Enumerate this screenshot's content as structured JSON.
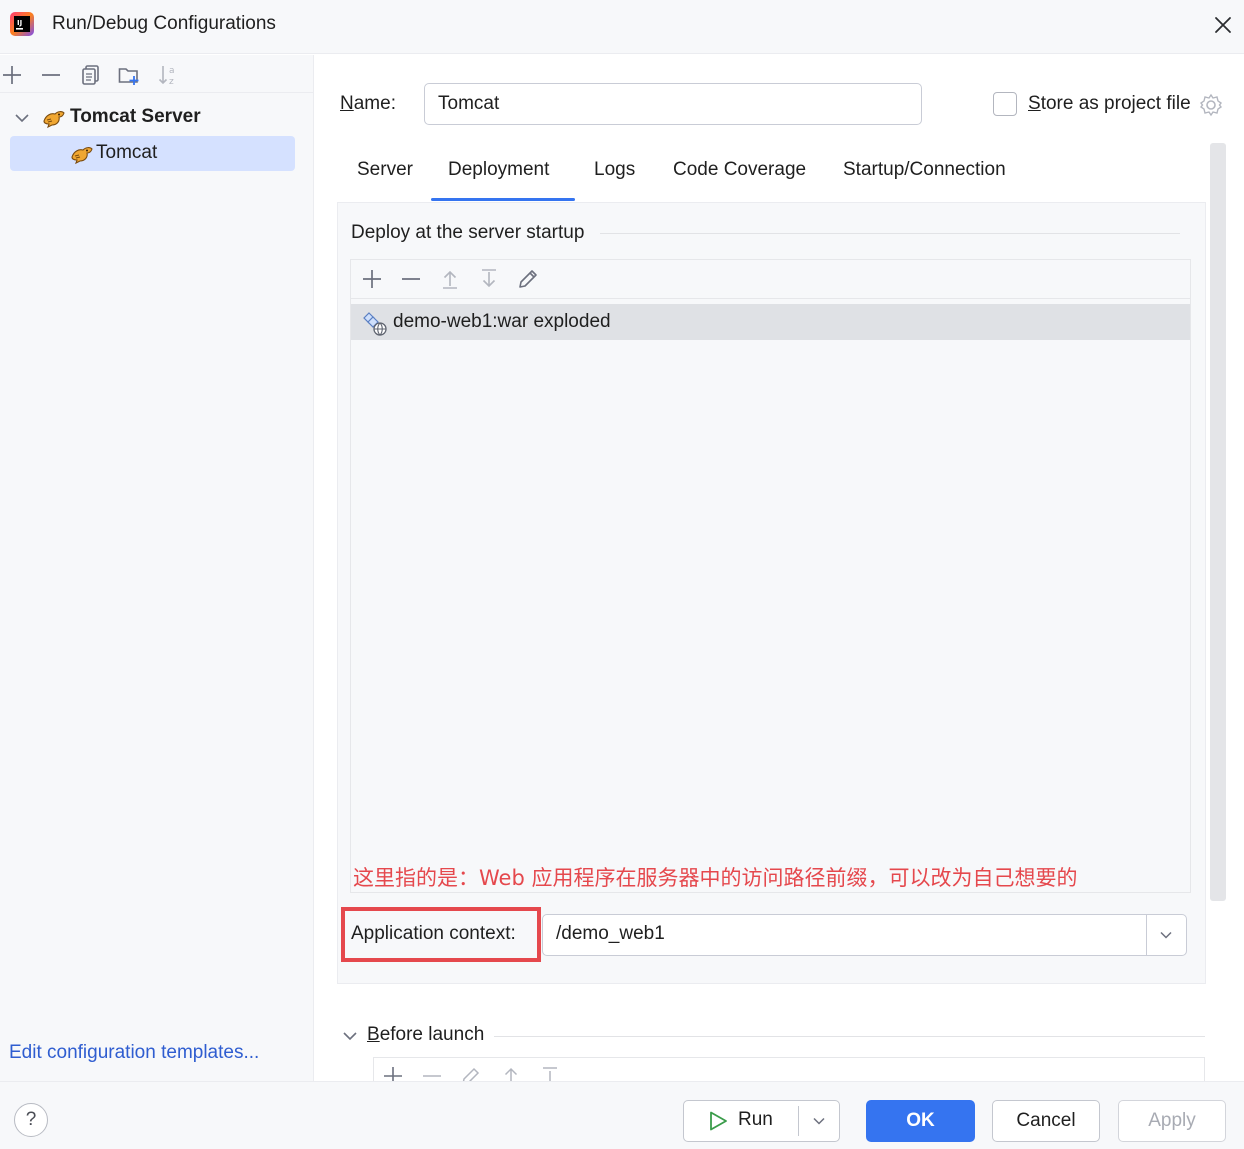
{
  "window": {
    "title": "Run/Debug Configurations"
  },
  "left": {
    "toolbar_icons": [
      "add-icon",
      "remove-icon",
      "copy-icon",
      "new-folder-icon",
      "sort-icon"
    ],
    "tree": {
      "group_label": "Tomcat Server",
      "item_label": "Tomcat"
    },
    "edit_templates_link": "Edit configuration templates..."
  },
  "form": {
    "name_label": "Name:",
    "name_value": "Tomcat",
    "store_label": "Store as project file",
    "store_checked": false
  },
  "tabs": [
    {
      "label": "Server",
      "active": false
    },
    {
      "label": "Deployment",
      "active": true
    },
    {
      "label": "Logs",
      "active": false
    },
    {
      "label": "Code Coverage",
      "active": false
    },
    {
      "label": "Startup/Connection",
      "active": false
    }
  ],
  "deployment": {
    "section_title": "Deploy at the server startup",
    "list_toolbar_icons": [
      "add-icon",
      "remove-icon",
      "move-up-icon",
      "move-down-icon",
      "edit-icon"
    ],
    "artifacts": [
      {
        "label": "demo-web1:war exploded",
        "selected": true
      }
    ],
    "annotation": "这里指的是：Web 应用程序在服务器中的访问路径前缀，可以改为自己想要的",
    "context_label": "Application context:",
    "context_value": "/demo_web1"
  },
  "before_launch": {
    "label": "Before launch"
  },
  "buttons": {
    "help": "?",
    "run": "Run",
    "ok": "OK",
    "cancel": "Cancel",
    "apply": "Apply"
  },
  "colors": {
    "accent": "#3574f0",
    "selection": "#d5e1ff",
    "annotation_red": "#e5484d",
    "link": "#2f5dd0"
  }
}
